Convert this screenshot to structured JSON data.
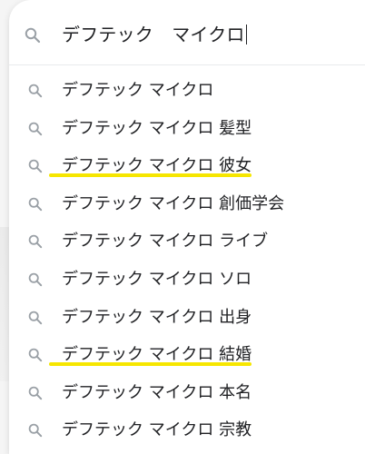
{
  "search": {
    "value": "デフテック　マイクロ",
    "icon": "search-icon"
  },
  "suggestions": [
    {
      "label": "デフテック マイクロ",
      "icon": "search-icon",
      "highlighted": false
    },
    {
      "label": "デフテック マイクロ 髪型",
      "icon": "search-icon",
      "highlighted": false
    },
    {
      "label": "デフテック マイクロ 彼女",
      "icon": "search-icon",
      "highlighted": true
    },
    {
      "label": "デフテック マイクロ 創価学会",
      "icon": "search-icon",
      "highlighted": false
    },
    {
      "label": "デフテック マイクロ ライブ",
      "icon": "search-icon",
      "highlighted": false
    },
    {
      "label": "デフテック マイクロ ソロ",
      "icon": "search-icon",
      "highlighted": false
    },
    {
      "label": "デフテック マイクロ 出身",
      "icon": "search-icon",
      "highlighted": false
    },
    {
      "label": "デフテック マイクロ 結婚",
      "icon": "search-icon",
      "highlighted": true
    },
    {
      "label": "デフテック マイクロ 本名",
      "icon": "search-icon",
      "highlighted": false
    },
    {
      "label": "デフテック マイクロ 宗教",
      "icon": "search-icon",
      "highlighted": false
    }
  ],
  "colors": {
    "text": "#202124",
    "icon": "#9aa0a6",
    "highlight": "#f6e600"
  }
}
